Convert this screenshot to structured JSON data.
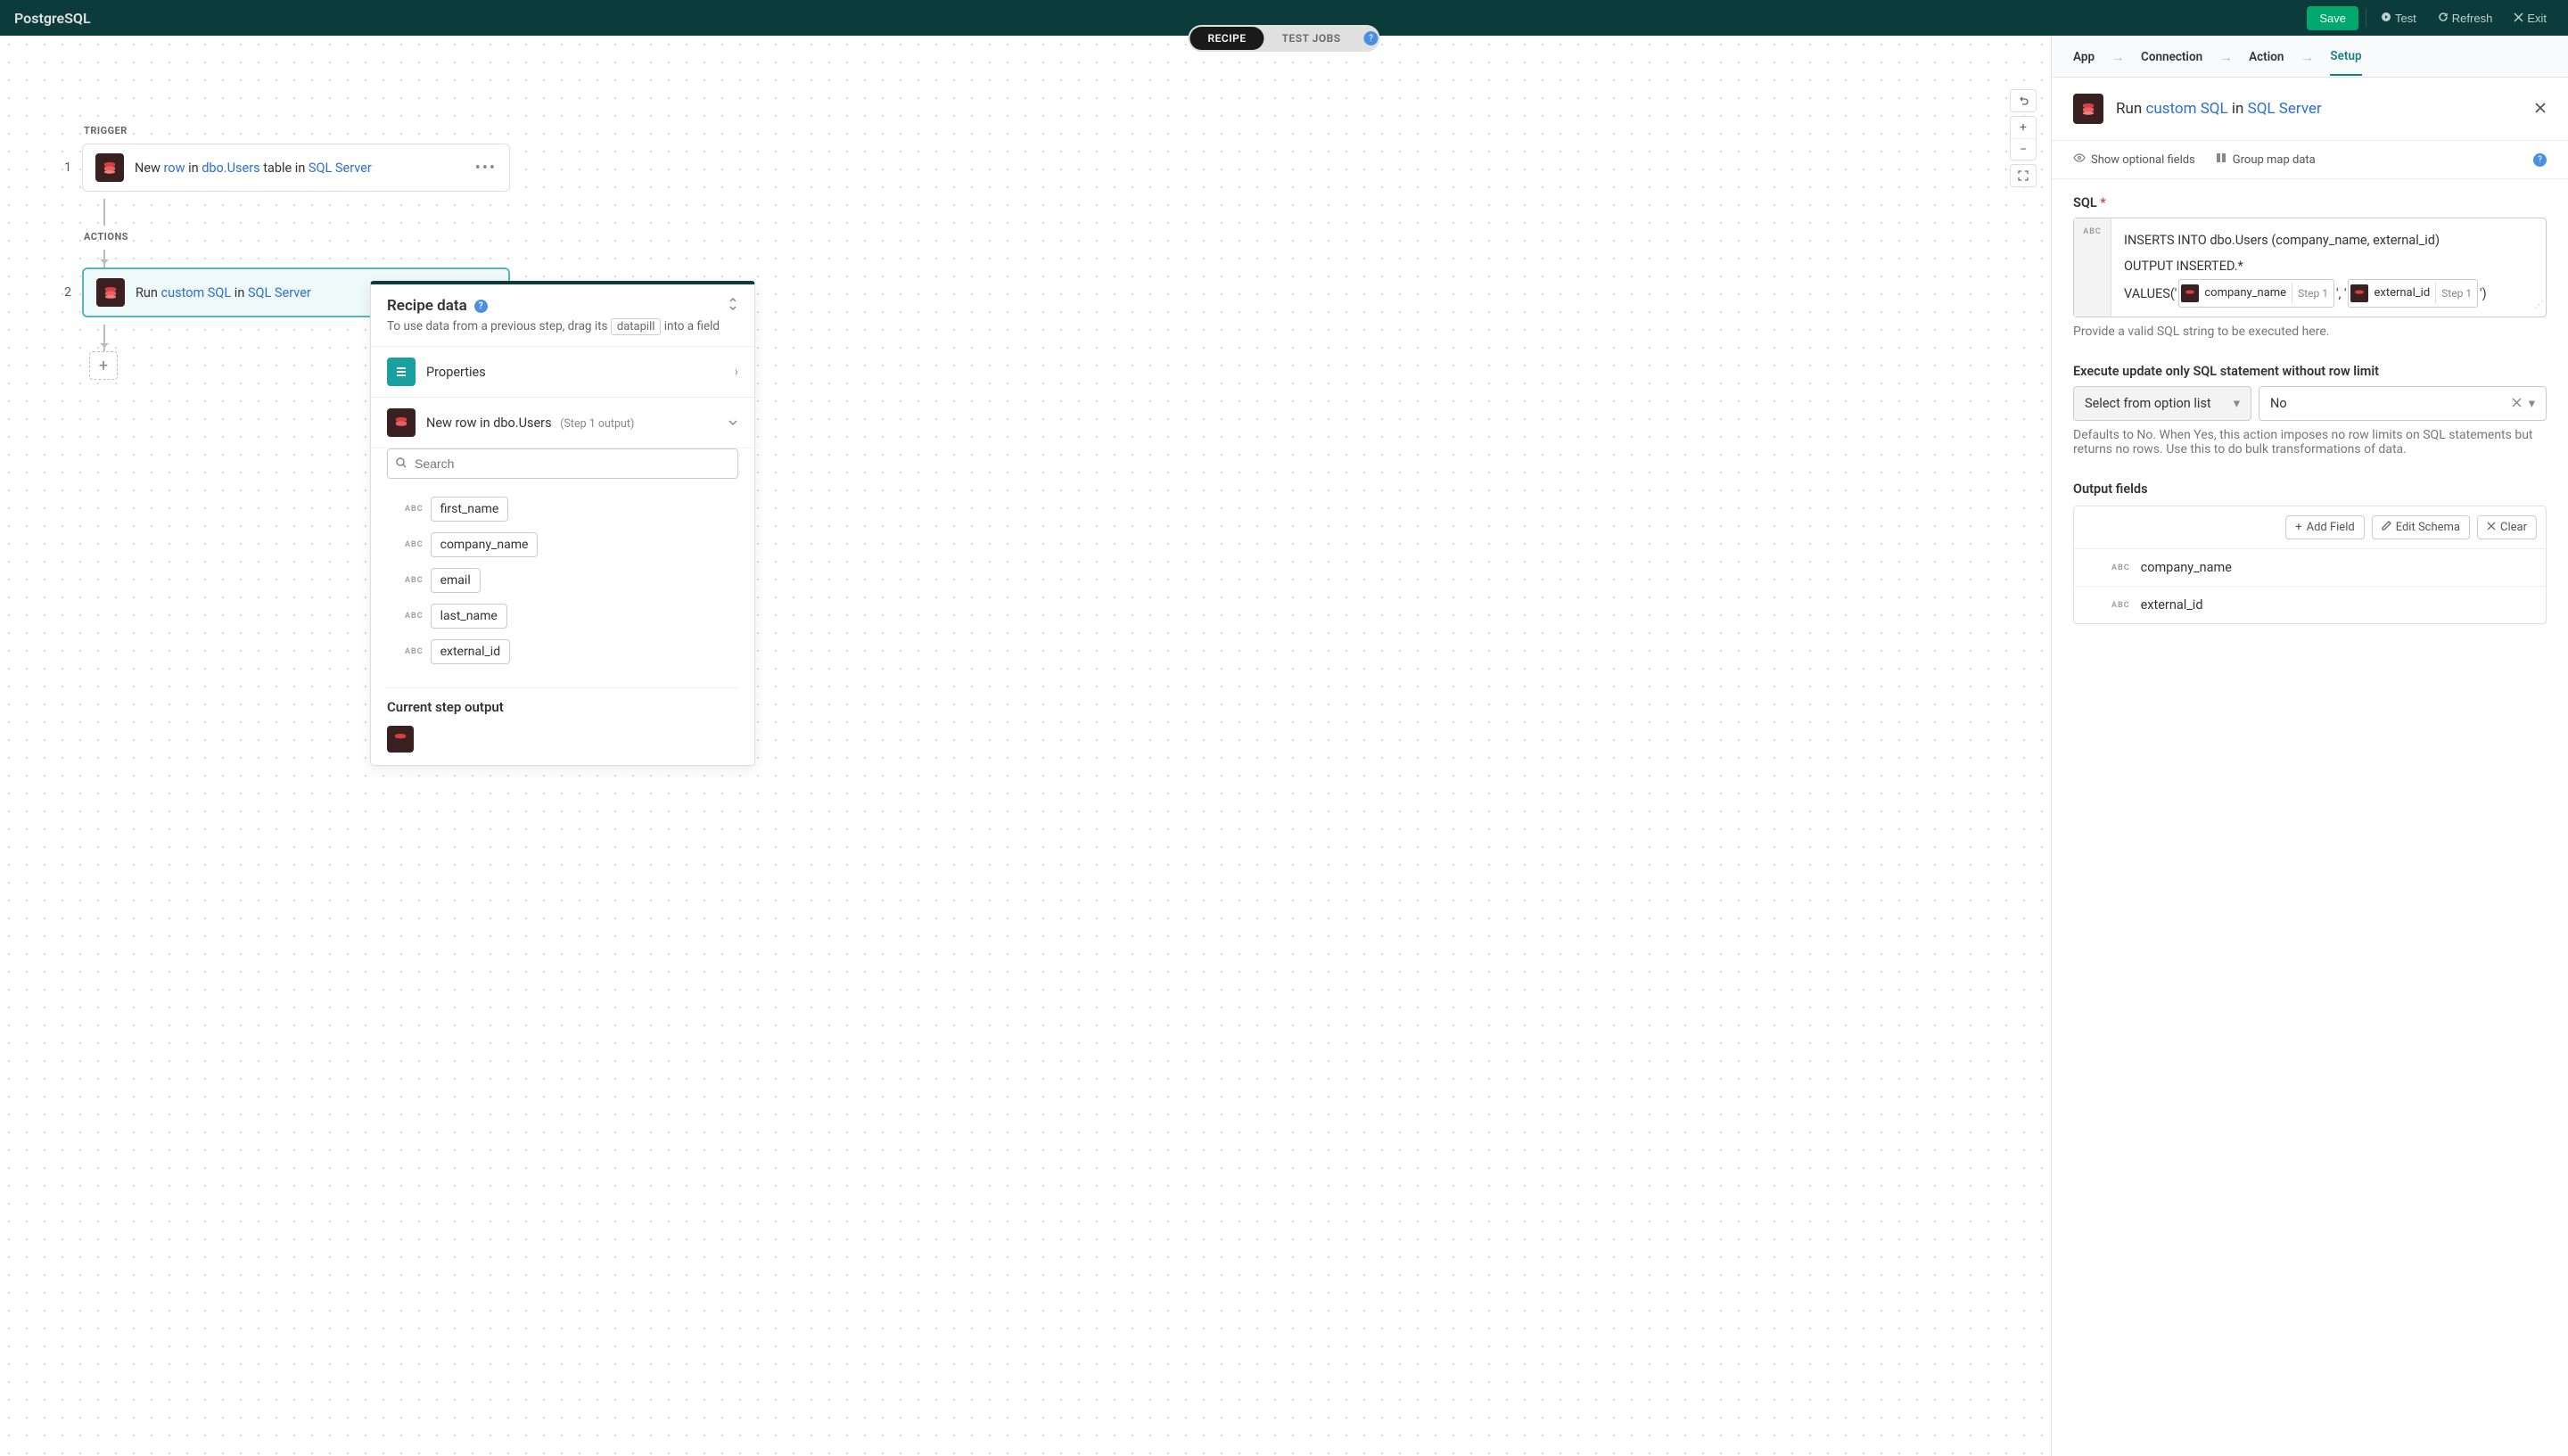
{
  "header": {
    "title": "PostgreSQL",
    "save": "Save",
    "test": "Test",
    "refresh": "Refresh",
    "exit": "Exit"
  },
  "tabs": {
    "recipe": "RECIPE",
    "test_jobs": "TEST JOBS"
  },
  "flow": {
    "trigger_label": "TRIGGER",
    "actions_label": "ACTIONS",
    "step1": {
      "num": "1",
      "t1": "New ",
      "t2": "row",
      "t3": " in ",
      "t4": "dbo.Users",
      "t5": " table in ",
      "t6": "SQL Server"
    },
    "step2": {
      "num": "2",
      "t1": "Run ",
      "t2": "custom SQL",
      "t3": " in ",
      "t4": "SQL Server"
    }
  },
  "recipe_data": {
    "title": "Recipe data",
    "sub1": "To use data from a previous step, drag its ",
    "sub_pill": "datapill",
    "sub2": " into a field",
    "properties": "Properties",
    "step_output_label": "New row in dbo.Users",
    "step_output_meta": "(Step 1 output)",
    "search_placeholder": "Search",
    "pills": [
      "first_name",
      "company_name",
      "email",
      "last_name",
      "external_id"
    ],
    "current_output": "Current step output",
    "abc": "ABC"
  },
  "side": {
    "tabs": [
      "App",
      "Connection",
      "Action",
      "Setup"
    ],
    "header": {
      "t1": "Run ",
      "t2": "custom SQL",
      "t3": " in ",
      "t4": "SQL Server"
    },
    "tools": {
      "optional": "Show optional fields",
      "group_map": "Group map data"
    },
    "sql": {
      "label": "SQL",
      "line1": "INSERTS INTO dbo.Users (company_name, external_id)",
      "line2": "OUTPUT INSERTED.*",
      "line3_a": "VALUES('",
      "pill1_name": "company_name",
      "pill1_step": "Step 1",
      "line3_mid": "', '",
      "pill2_name": "external_id",
      "pill2_step": "Step 1",
      "line3_end": "')",
      "help": "Provide a valid SQL string to be executed here.",
      "abc": "ABC"
    },
    "row_limit": {
      "label": "Execute update only SQL statement without row limit",
      "select_placeholder": "Select from option list",
      "value": "No",
      "help": "Defaults to No. When Yes, this action imposes no row limits on SQL statements but returns no rows. Use this to do bulk transformations of data."
    },
    "output": {
      "label": "Output fields",
      "add": "Add Field",
      "edit": "Edit Schema",
      "clear": "Clear",
      "rows": [
        "company_name",
        "external_id"
      ],
      "abc": "ABC"
    }
  }
}
